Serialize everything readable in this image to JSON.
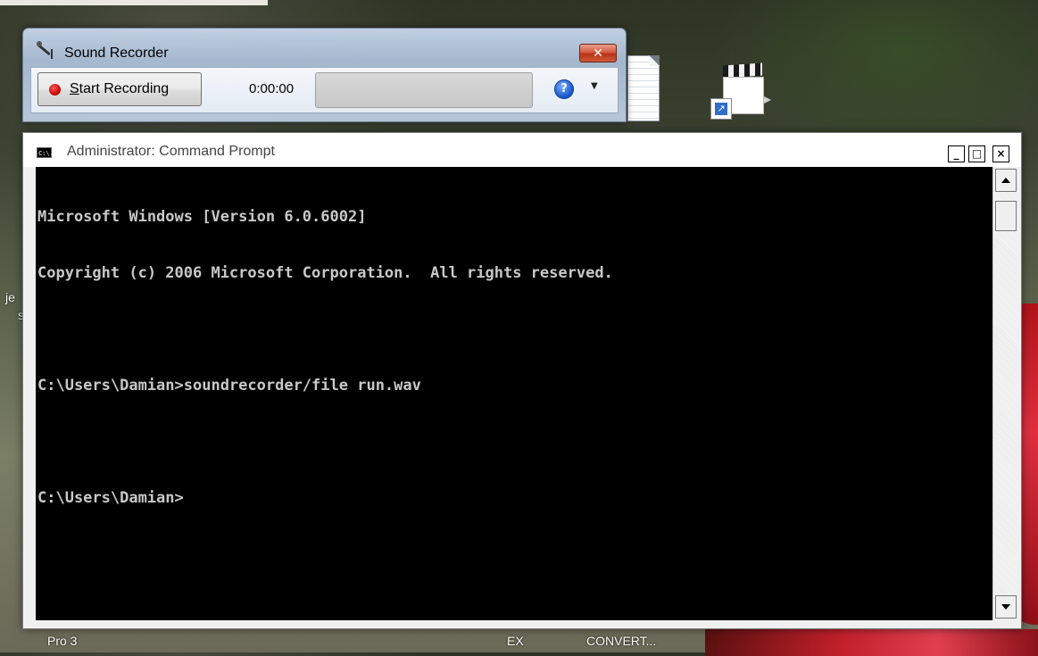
{
  "desktop": {
    "left_text_1": "je",
    "left_text_2": "s",
    "taskbar_items": [
      {
        "label": "Pro 3"
      },
      {
        "label": "EX"
      },
      {
        "label": "CONVERT..."
      }
    ]
  },
  "sound_recorder": {
    "title": "Sound Recorder",
    "close_glyph": "✕",
    "start_button_label": "Start Recording",
    "elapsed_time": "0:00:00",
    "help_glyph": "?",
    "dropdown_glyph": "▼",
    "icons": {
      "app": "microphone-icon",
      "record": "record-dot-icon",
      "help": "help-icon"
    }
  },
  "command_prompt": {
    "title": "Administrator: Command Prompt",
    "icon_text": "C:\\.",
    "controls": {
      "minimize": "_",
      "maximize": "□",
      "close": "×"
    },
    "lines": [
      "Microsoft Windows [Version 6.0.6002]",
      "Copyright (c) 2006 Microsoft Corporation.  All rights reserved.",
      "",
      "C:\\Users\\Damian>soundrecorder/file run.wav",
      "",
      "C:\\Users\\Damian>"
    ],
    "colors": {
      "background": "#000000",
      "text": "#c8c8c8"
    }
  }
}
